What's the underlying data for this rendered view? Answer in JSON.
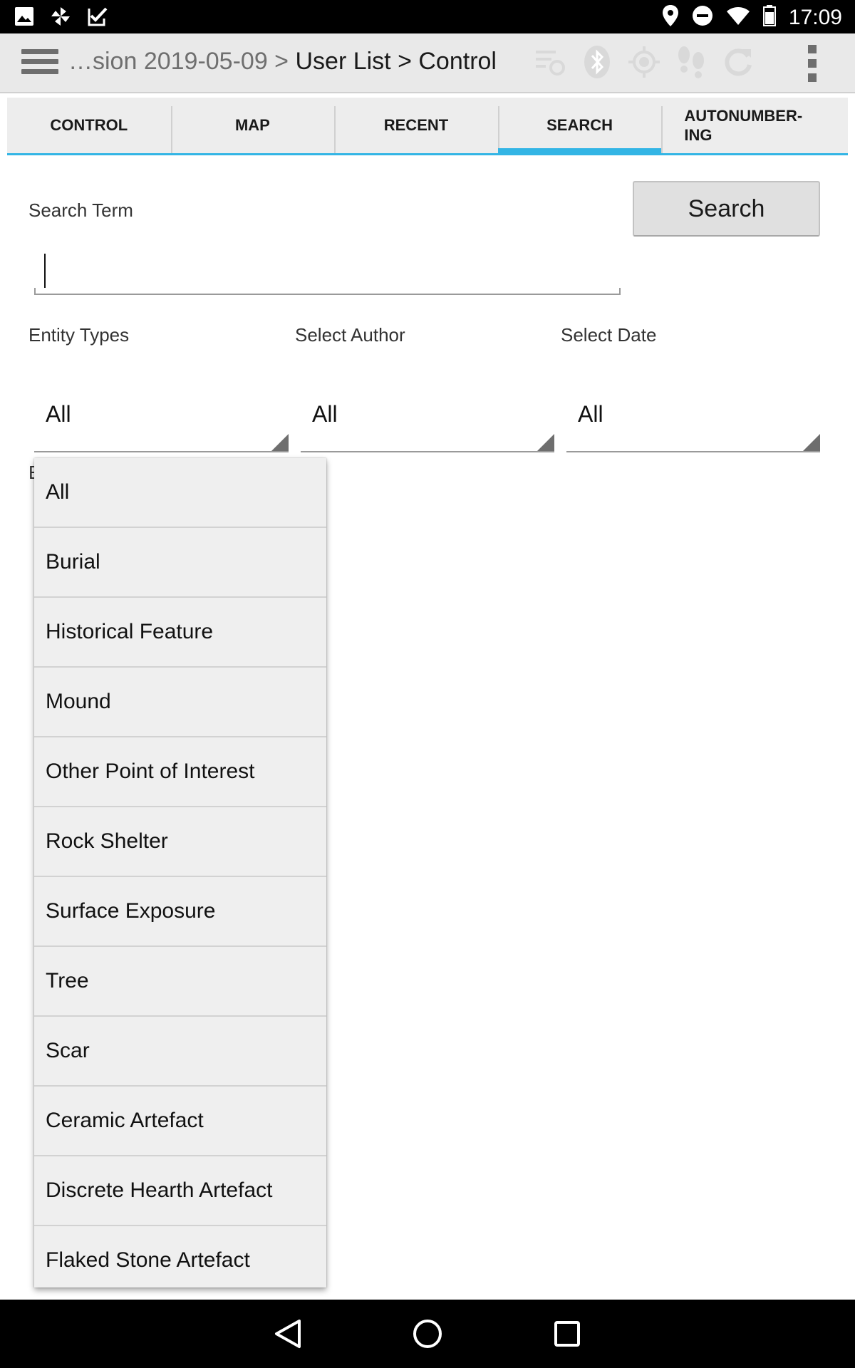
{
  "status_bar": {
    "time": "17:09",
    "left_icons": [
      "image-icon",
      "pinwheel-icon",
      "checkbox-flag-icon"
    ],
    "right_icons": [
      "location-icon",
      "do-not-disturb-icon",
      "wifi-icon",
      "battery-icon"
    ]
  },
  "action_bar": {
    "breadcrumb_muted": "…sion 2019-05-09 > ",
    "breadcrumb_main": "User List > Control",
    "icons": [
      "sync-status-icon",
      "bluetooth-icon",
      "gps-icon",
      "footsteps-icon",
      "refresh-icon"
    ]
  },
  "tabs": [
    {
      "label": "CONTROL"
    },
    {
      "label": "MAP"
    },
    {
      "label": "RECENT"
    },
    {
      "label": "SEARCH",
      "active": true
    },
    {
      "label": "AUTONUMBER-",
      "label2": "ING"
    }
  ],
  "form": {
    "search_term_label": "Search Term",
    "search_button_label": "Search",
    "search_input_value": "",
    "entity_types_label": "Entity Types",
    "select_author_label": "Select Author",
    "select_date_label": "Select Date",
    "entity_types_value": "All",
    "author_value": "All",
    "date_value": "All",
    "hidden_label_initial": "E"
  },
  "dropdown": {
    "items": [
      "All",
      "Burial",
      "Historical Feature",
      "Mound",
      "Other Point of Interest",
      "Rock Shelter",
      "Surface Exposure",
      "Tree",
      "Scar",
      "Ceramic Artefact",
      "Discrete Hearth Artefact",
      "Flaked Stone Artefact"
    ]
  },
  "colors": {
    "accent": "#33b5e5",
    "action_bar_bg": "#e9e9e9",
    "dropdown_bg": "#efefef"
  }
}
